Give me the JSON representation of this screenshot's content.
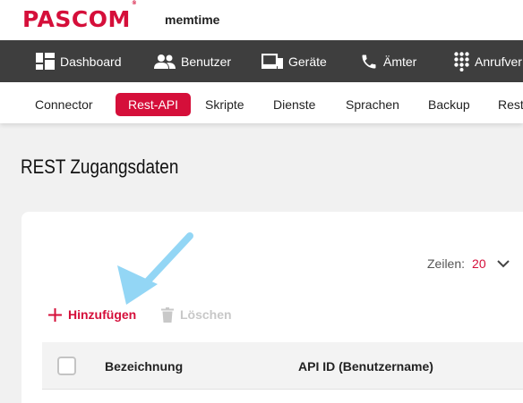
{
  "brand": {
    "logo": "PASCOM",
    "reg": "®",
    "app_name": "memtime",
    "accent": "#d50f3a"
  },
  "main_nav": [
    {
      "label": "Dashboard",
      "icon": "dashboard-icon"
    },
    {
      "label": "Benutzer",
      "icon": "users-icon"
    },
    {
      "label": "Geräte",
      "icon": "devices-icon"
    },
    {
      "label": "Ämter",
      "icon": "phone-icon"
    },
    {
      "label": "Anrufver",
      "icon": "dialpad-icon"
    }
  ],
  "sub_nav": [
    {
      "label": "Connector",
      "active": false
    },
    {
      "label": "Rest-API",
      "active": true
    },
    {
      "label": "Skripte",
      "active": false
    },
    {
      "label": "Dienste",
      "active": false
    },
    {
      "label": "Sprachen",
      "active": false
    },
    {
      "label": "Backup",
      "active": false
    },
    {
      "label": "Rest",
      "active": false
    }
  ],
  "page": {
    "title": "REST Zugangsdaten"
  },
  "pagination": {
    "rows_label": "Zeilen:",
    "rows_value": "20"
  },
  "actions": {
    "add_label": "Hinzufügen",
    "delete_label": "Löschen"
  },
  "table": {
    "columns": [
      "Bezeichnung",
      "API ID (Benutzername)"
    ]
  },
  "annotation": {
    "color": "#93d6f5",
    "icon": "arrow-pointer-icon"
  }
}
